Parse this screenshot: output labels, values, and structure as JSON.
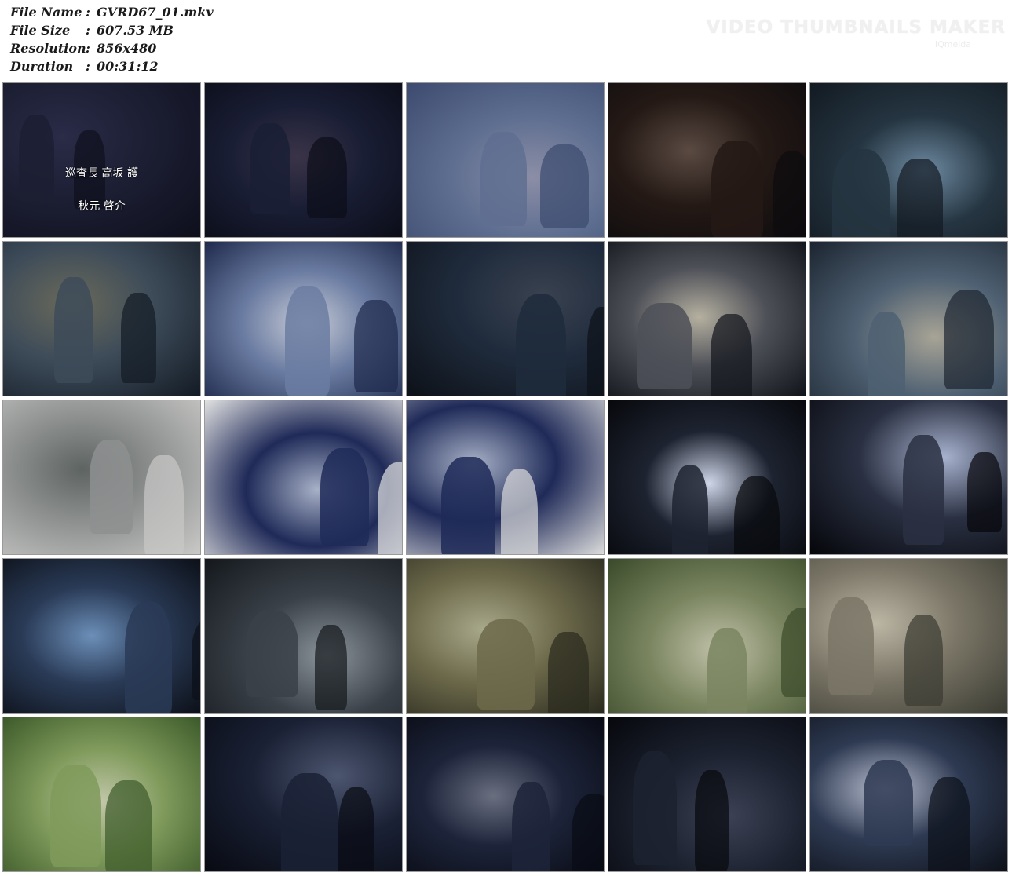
{
  "info": {
    "rows": [
      {
        "label": "File Name",
        "sep": ":",
        "value": "GVRD67_01.mkv"
      },
      {
        "label": "File Size",
        "sep": ":",
        "value": "607.53 MB"
      },
      {
        "label": "Resolution",
        "sep": ":",
        "value": "856x480"
      },
      {
        "label": "Duration",
        "sep": ":",
        "value": "00:31:12"
      }
    ]
  },
  "watermark": {
    "title": "VIDEO THUMBNAILS MAKER",
    "sub": "IQmeida"
  },
  "thumbnails": [
    {
      "scene": "dark-credits",
      "colors": [
        "#0e0f1c",
        "#1c1e33",
        "#2a2c48"
      ],
      "caption_1": "巡査長 高坂 護",
      "caption_2": "秋元 啓介"
    },
    {
      "scene": "woman-with-gun-dark",
      "colors": [
        "#0b0d18",
        "#1a1e35",
        "#3b3448"
      ]
    },
    {
      "scene": "hands-bound-overhead",
      "colors": [
        "#3b4a6e",
        "#5f6f91",
        "#8c8ea6"
      ]
    },
    {
      "scene": "hanging-scaffold-night",
      "colors": [
        "#0d0b0e",
        "#241915",
        "#5a4a42"
      ]
    },
    {
      "scene": "scaffold-soldiers-night",
      "colors": [
        "#121a22",
        "#253541",
        "#6e8aa1"
      ]
    },
    {
      "scene": "hanging-tilted",
      "colors": [
        "#131b25",
        "#3d4b59",
        "#6a6a5a"
      ]
    },
    {
      "scene": "closeup-bound-woman",
      "colors": [
        "#1e2a4c",
        "#6b7ca2",
        "#c8ccd6"
      ]
    },
    {
      "scene": "soldiers-dark-closeup",
      "colors": [
        "#0d1118",
        "#1f2b3c",
        "#3a4250"
      ]
    },
    {
      "scene": "cabin-light-soldiers",
      "colors": [
        "#11141b",
        "#4e5058",
        "#b5b0a0"
      ]
    },
    {
      "scene": "scaffold-smoke",
      "colors": [
        "#1c2530",
        "#4e6072",
        "#a8a496"
      ]
    },
    {
      "scene": "city-skyline",
      "colors": [
        "#c9c9c7",
        "#8e9190",
        "#5e6462"
      ]
    },
    {
      "scene": "police-officers-day",
      "colors": [
        "#e2e2e2",
        "#1f2a58",
        "#a7b1c7"
      ]
    },
    {
      "scene": "police-salute-day",
      "colors": [
        "#dcdcdc",
        "#1f2a58",
        "#a7b1c7"
      ]
    },
    {
      "scene": "van-headlights-night",
      "colors": [
        "#07080c",
        "#1d2330",
        "#cfd6e8"
      ]
    },
    {
      "scene": "van-door-night",
      "colors": [
        "#05060a",
        "#2a3042",
        "#a7b2ce"
      ]
    },
    {
      "scene": "gasmask-night",
      "colors": [
        "#0c1018",
        "#2a3b57",
        "#6c8fb8"
      ]
    },
    {
      "scene": "van-soldier-night",
      "colors": [
        "#14181d",
        "#3a4148",
        "#8c949b"
      ]
    },
    {
      "scene": "masked-man-outdoor",
      "colors": [
        "#2a2a1e",
        "#6d6a4b",
        "#a8a88a"
      ]
    },
    {
      "scene": "field-walk",
      "colors": [
        "#3a4a2a",
        "#7a8560",
        "#c1c1a9"
      ]
    },
    {
      "scene": "chains-outdoor",
      "colors": [
        "#3a3b32",
        "#7a7566",
        "#bcb7a5"
      ]
    },
    {
      "scene": "fence-fight",
      "colors": [
        "#3c5a2a",
        "#7f9a5b",
        "#c2c7a9"
      ]
    },
    {
      "scene": "officer-woman-night",
      "colors": [
        "#080a12",
        "#1a2135",
        "#4d5670"
      ]
    },
    {
      "scene": "officer-woman-night-2",
      "colors": [
        "#090b14",
        "#1d243a",
        "#6a6f80"
      ]
    },
    {
      "scene": "struggle-night",
      "colors": [
        "#07080d",
        "#1c2230",
        "#3c4254"
      ]
    },
    {
      "scene": "woman-ground-night",
      "colors": [
        "#0c1018",
        "#2e3a52",
        "#b9bfd1"
      ]
    }
  ]
}
